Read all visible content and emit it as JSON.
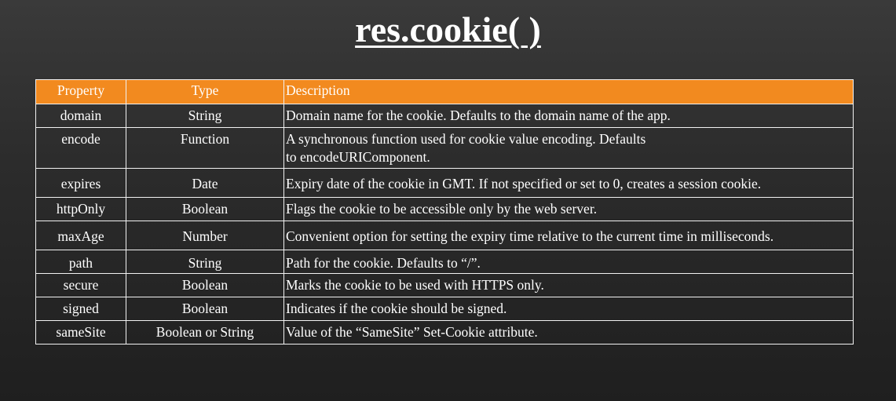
{
  "slide": {
    "title": "res.cookie( )"
  },
  "table": {
    "header": {
      "property": "Property",
      "type": "Type",
      "description": "Description"
    },
    "rows": [
      {
        "property": "domain",
        "type": "String",
        "description": "Domain name for the cookie. Defaults to the domain name of the app."
      },
      {
        "property": "encode",
        "type": "Function",
        "description_line1": "A synchronous function used for cookie value encoding. Defaults",
        "description_line2": "to encodeURIComponent."
      },
      {
        "property": "expires",
        "type": "Date",
        "description": "Expiry date of the cookie in GMT. If not specified or set to 0, creates a session cookie."
      },
      {
        "property": "httpOnly",
        "type": "Boolean",
        "description": "Flags the cookie to be accessible only by the web server."
      },
      {
        "property": "maxAge",
        "type": "Number",
        "description": "Convenient option for setting the expiry time relative to the current time in milliseconds."
      },
      {
        "property": "path",
        "type": "String",
        "description": "Path for the cookie. Defaults to “/”."
      },
      {
        "property": "secure",
        "type": "Boolean",
        "description": "Marks the cookie to be used with HTTPS only."
      },
      {
        "property": "signed",
        "type": "Boolean",
        "description": "Indicates if the cookie should be signed."
      },
      {
        "property": "sameSite",
        "type": "Boolean or String",
        "description": "Value of the “SameSite” Set-Cookie attribute."
      }
    ]
  },
  "colors": {
    "header_bg": "#f28a1f",
    "border": "#f2f2f2",
    "text": "#ffffff",
    "background_top": "#3a3a3a",
    "background_bottom": "#1f1f1f"
  }
}
